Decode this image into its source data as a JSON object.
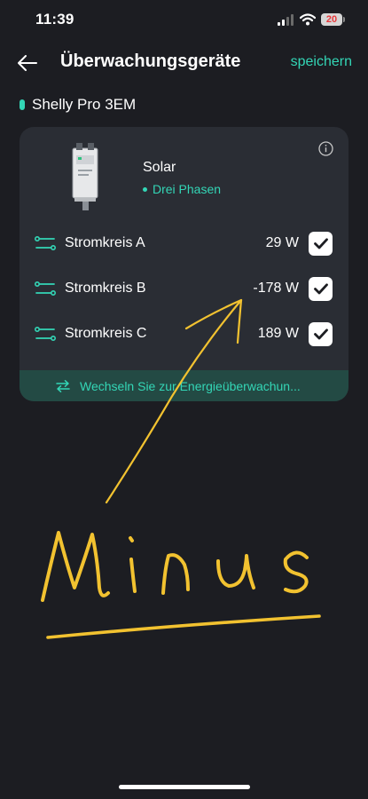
{
  "status_bar": {
    "time": "11:39",
    "battery_level": "20",
    "icons": [
      "signal-icon",
      "wifi-icon",
      "battery-icon"
    ]
  },
  "header": {
    "back_icon": "arrow-left-icon",
    "title": "Überwachungsgeräte",
    "save_label": "speichern"
  },
  "device": {
    "name": "Shelly Pro 3EM",
    "label": "Solar",
    "phase": "Drei Phasen",
    "info_icon": "info-icon"
  },
  "circuits": [
    {
      "label": "Stromkreis A",
      "value": "29 W",
      "checked": true
    },
    {
      "label": "Stromkreis B",
      "value": "-178 W",
      "checked": true
    },
    {
      "label": "Stromkreis C",
      "value": "189 W",
      "checked": true
    }
  ],
  "switch": {
    "icon": "swap-arrows-icon",
    "label": "Wechseln Sie zur Energieüberwachun..."
  },
  "annotation": {
    "text": "Minus",
    "color": "#f2c230"
  },
  "colors": {
    "background": "#1c1d22",
    "card": "#2a2d34",
    "accent": "#33d6b6",
    "switch_bar": "#234a44"
  }
}
